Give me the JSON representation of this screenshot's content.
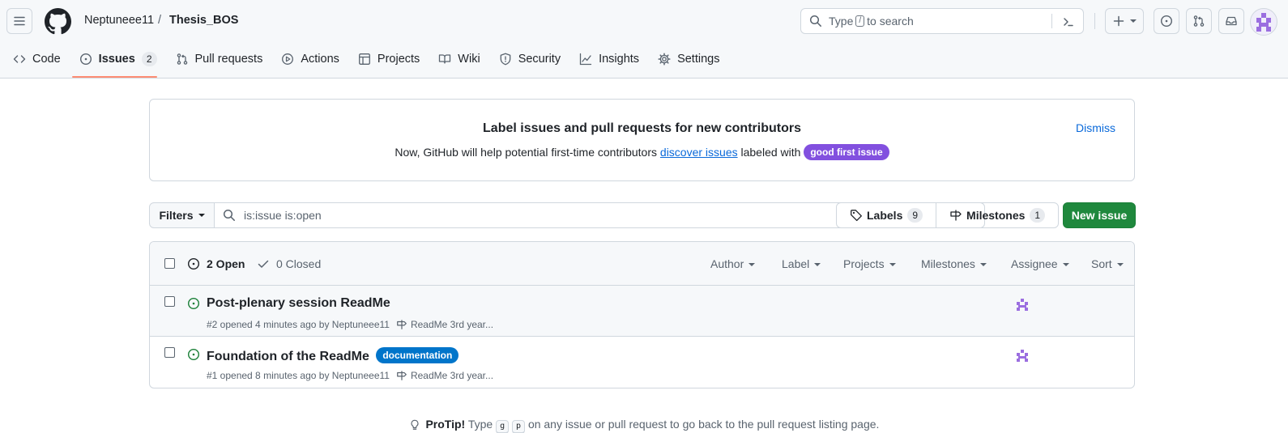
{
  "header": {
    "owner": "Neptuneee11",
    "separator": "/",
    "repo": "Thesis_BOS",
    "search_prefix": "Type",
    "search_key": "/",
    "search_suffix": "to search"
  },
  "tabs": [
    {
      "label": "Code",
      "icon": "code-icon"
    },
    {
      "label": "Issues",
      "icon": "issue-opened-icon",
      "count": "2",
      "selected": true
    },
    {
      "label": "Pull requests",
      "icon": "git-pull-request-icon"
    },
    {
      "label": "Actions",
      "icon": "play-icon"
    },
    {
      "label": "Projects",
      "icon": "table-icon"
    },
    {
      "label": "Wiki",
      "icon": "book-icon"
    },
    {
      "label": "Security",
      "icon": "shield-icon"
    },
    {
      "label": "Insights",
      "icon": "graph-icon"
    },
    {
      "label": "Settings",
      "icon": "gear-icon"
    }
  ],
  "banner": {
    "title": "Label issues and pull requests for new contributors",
    "text_before": "Now, GitHub will help potential first-time contributors",
    "link": "discover issues",
    "text_after": "labeled with",
    "pill": "good first issue",
    "dismiss": "Dismiss"
  },
  "filters": {
    "button": "Filters",
    "query": "is:issue is:open"
  },
  "labels": {
    "label": "Labels",
    "count": "9"
  },
  "milestones": {
    "label": "Milestones",
    "count": "1"
  },
  "new_issue": "New issue",
  "list_header": {
    "open": "2 Open",
    "closed": "0 Closed",
    "filters": [
      "Author",
      "Label",
      "Projects",
      "Milestones",
      "Assignee",
      "Sort"
    ]
  },
  "issues": [
    {
      "title": "Post-plenary session ReadMe",
      "meta": "#2 opened 4 minutes ago by Neptuneee11",
      "milestone": "ReadMe 3rd year...",
      "label": ""
    },
    {
      "title": "Foundation of the ReadMe",
      "meta": "#1 opened 8 minutes ago by Neptuneee11",
      "milestone": "ReadMe 3rd year...",
      "label": "documentation"
    }
  ],
  "protip": {
    "bold": "ProTip!",
    "before": "Type",
    "k1": "g",
    "k2": "p",
    "after": "on any issue or pull request to go back to the pull request listing page."
  },
  "colors": {
    "accent_green": "#1f883d",
    "link": "#0969da",
    "tab_underline": "#fd8c73",
    "open_icon": "#1a7f37",
    "good_first_issue": "#8250df",
    "documentation": "#0075ca"
  }
}
